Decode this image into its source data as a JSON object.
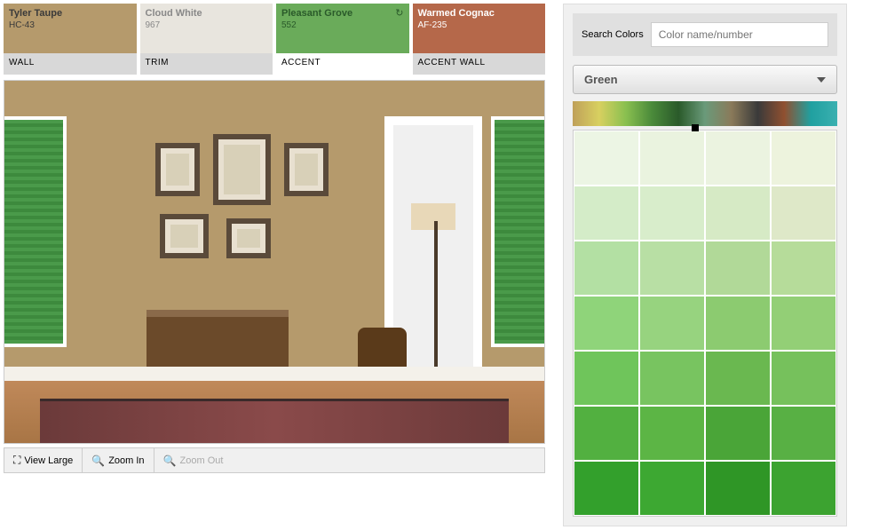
{
  "swatches": [
    {
      "name": "Tyler Taupe",
      "code": "HC-43",
      "label": "WALL",
      "color": "#b59a6c",
      "textColor": "#3a3a3a",
      "active": false
    },
    {
      "name": "Cloud White",
      "code": "967",
      "label": "TRIM",
      "color": "#e8e5de",
      "textColor": "#888",
      "active": false
    },
    {
      "name": "Pleasant Grove",
      "code": "552",
      "label": "ACCENT",
      "color": "#6aab5a",
      "textColor": "#2a5a2a",
      "active": true,
      "arrow": "↻"
    },
    {
      "name": "Warmed Cognac",
      "code": "AF-235",
      "label": "ACCENT WALL",
      "color": "#b5684a",
      "textColor": "#fff",
      "active": false
    }
  ],
  "controls": {
    "viewLarge": "View Large",
    "zoomIn": "Zoom In",
    "zoomOut": "Zoom Out"
  },
  "search": {
    "label": "Search Colors",
    "placeholder": "Color name/number"
  },
  "dropdown": {
    "selected": "Green"
  },
  "palette": [
    "#ecf5e4",
    "#eaf3df",
    "#ebf3e0",
    "#edf3dd",
    "#d4ecc8",
    "#d8edcb",
    "#d6eac5",
    "#dee8c8",
    "#b3e0a3",
    "#b8dfa4",
    "#b1d998",
    "#b6dc9a",
    "#8fd47a",
    "#97d37f",
    "#8ccb70",
    "#93cf76",
    "#6fc55b",
    "#78c460",
    "#6ab850",
    "#76c15c",
    "#52b040",
    "#5cb545",
    "#4aa538",
    "#58b044",
    "#33a02c",
    "#3da832",
    "#2f9626",
    "#3ca330"
  ]
}
